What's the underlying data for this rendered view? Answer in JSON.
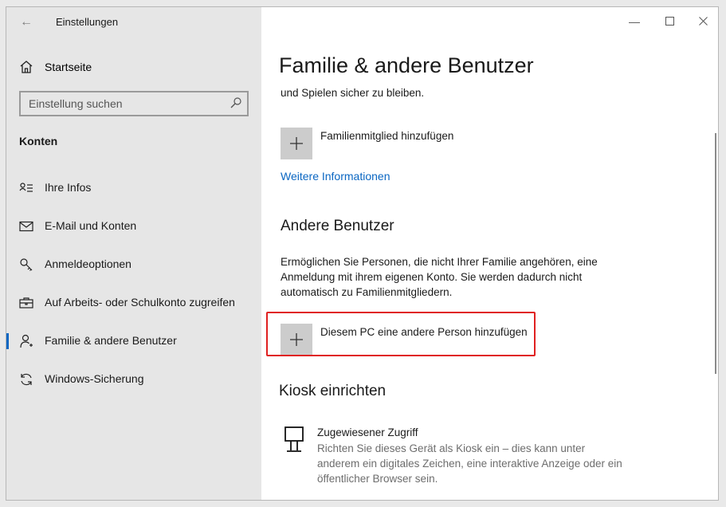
{
  "window": {
    "title": "Einstellungen"
  },
  "sidebar": {
    "home_label": "Startseite",
    "search_placeholder": "Einstellung suchen",
    "section": "Konten",
    "items": [
      {
        "label": "Ihre Infos",
        "icon": "person-card-icon",
        "active": false
      },
      {
        "label": "E-Mail und Konten",
        "icon": "mail-icon",
        "active": false
      },
      {
        "label": "Anmeldeoptionen",
        "icon": "key-icon",
        "active": false
      },
      {
        "label": "Auf Arbeits- oder Schulkonto zugreifen",
        "icon": "briefcase-icon",
        "active": false
      },
      {
        "label": "Familie & andere Benutzer",
        "icon": "person-icon",
        "active": true
      },
      {
        "label": "Windows-Sicherung",
        "icon": "sync-icon",
        "active": false
      }
    ]
  },
  "content": {
    "page_title": "Familie & andere Benutzer",
    "family_text_partial": "und Spielen sicher zu bleiben.",
    "add_family_label": "Familienmitglied hinzufügen",
    "more_info_link": "Weitere Informationen",
    "other_users_heading": "Andere Benutzer",
    "other_users_text": "Ermöglichen Sie Personen, die nicht Ihrer Familie angehören, eine Anmeldung mit ihrem eigenen Konto. Sie werden dadurch nicht automatisch zu Familienmitgliedern.",
    "add_other_label": "Diesem PC eine andere Person hinzufügen",
    "kiosk_heading": "Kiosk einrichten",
    "kiosk_title": "Zugewiesener Zugriff",
    "kiosk_desc": "Richten Sie dieses Gerät als Kiosk ein – dies kann unter anderem ein digitales Zeichen, eine interaktive Anzeige oder ein öffentlicher Browser sein."
  },
  "colors": {
    "accent": "#0a66c2",
    "highlight": "#e02020",
    "sidebar_bg": "#e6e6e6"
  }
}
